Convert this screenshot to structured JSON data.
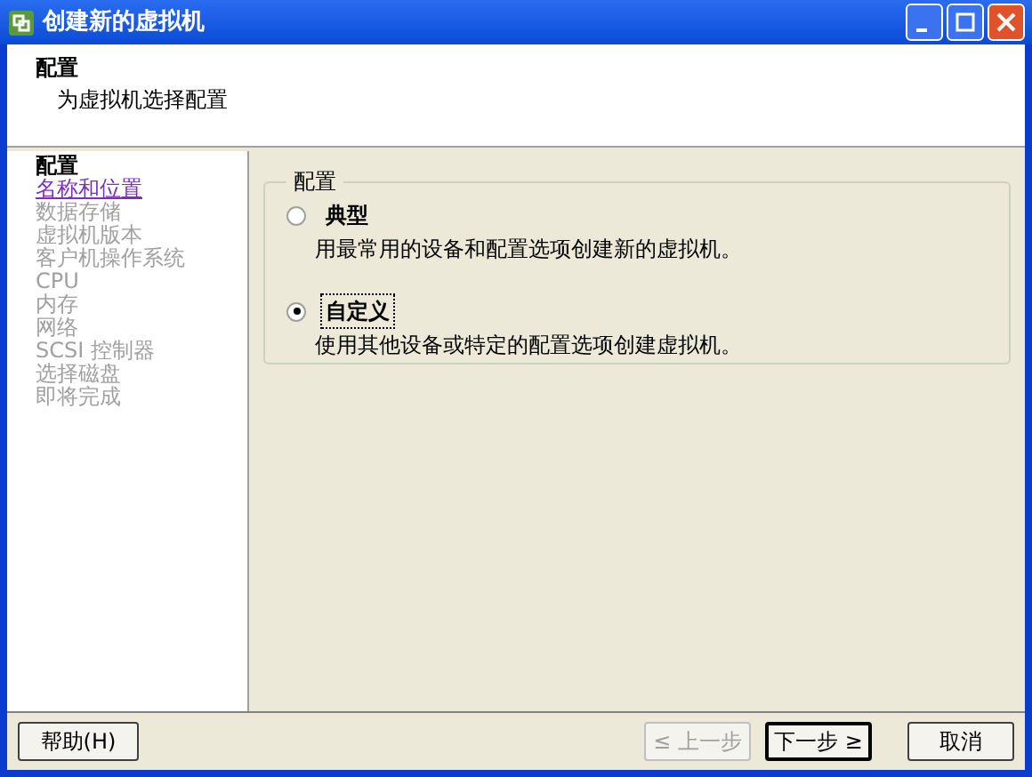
{
  "window": {
    "title": "创建新的虚拟机"
  },
  "header": {
    "title": "配置",
    "subtitle": "为虚拟机选择配置"
  },
  "sidebar": {
    "items": [
      {
        "label": "配置",
        "kind": "current"
      },
      {
        "label": "名称和位置",
        "kind": "link"
      },
      {
        "label": "数据存储",
        "kind": "disabled"
      },
      {
        "label": "虚拟机版本",
        "kind": "disabled"
      },
      {
        "label": "客户机操作系统",
        "kind": "disabled"
      },
      {
        "label": "CPU",
        "kind": "disabled"
      },
      {
        "label": "内存",
        "kind": "disabled"
      },
      {
        "label": "网络",
        "kind": "disabled"
      },
      {
        "label": "SCSI 控制器",
        "kind": "disabled"
      },
      {
        "label": "选择磁盘",
        "kind": "disabled"
      },
      {
        "label": "即将完成",
        "kind": "disabled"
      }
    ]
  },
  "group": {
    "title": "配置",
    "options": [
      {
        "label": "典型",
        "description": "用最常用的设备和配置选项创建新的虚拟机。",
        "selected": false,
        "focused": false
      },
      {
        "label": "自定义",
        "description": "使用其他设备或特定的配置选项创建虚拟机。",
        "selected": true,
        "focused": true
      }
    ]
  },
  "buttons": {
    "help": {
      "label": "帮助(H)"
    },
    "nav": [
      {
        "label": "≤ 上一步",
        "disabled": true,
        "default": false
      },
      {
        "label": "下一步 ≥",
        "disabled": false,
        "default": true
      },
      {
        "label": "取消",
        "disabled": false,
        "default": false
      }
    ]
  }
}
